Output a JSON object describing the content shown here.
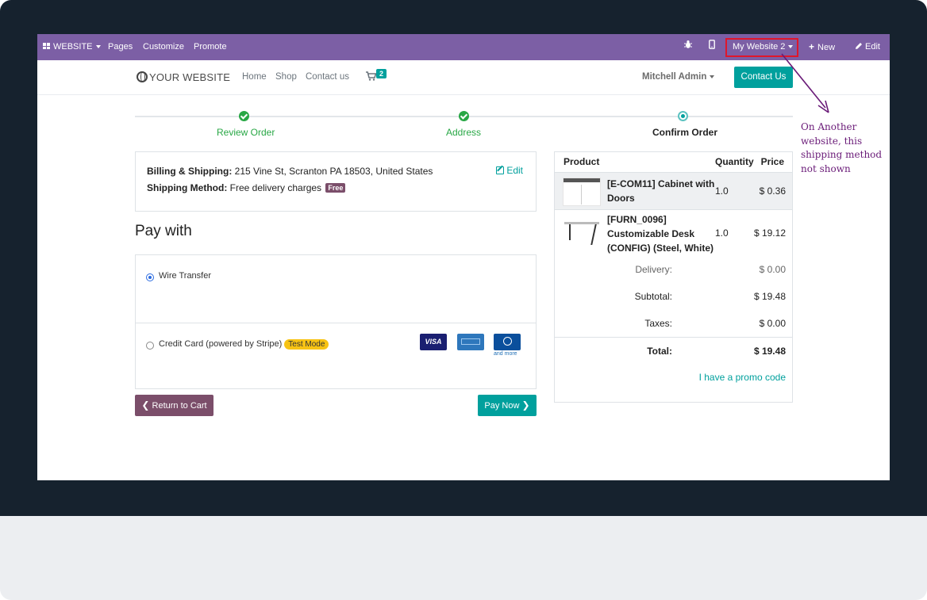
{
  "admin_bar": {
    "website_menu": "WEBSITE",
    "pages": "Pages",
    "customize": "Customize",
    "promote": "Promote",
    "website_switcher": "My Website 2",
    "new": "New",
    "edit": "Edit"
  },
  "header": {
    "logo": "YOUR WEBSITE",
    "nav": [
      "Home",
      "Shop",
      "Contact us"
    ],
    "cart_count": "2",
    "user": "Mitchell Admin",
    "contact_button": "Contact Us"
  },
  "progress": {
    "steps": [
      {
        "label": "Review Order",
        "state": "done"
      },
      {
        "label": "Address",
        "state": "done"
      },
      {
        "label": "Confirm Order",
        "state": "current"
      }
    ]
  },
  "billing": {
    "billing_label": "Billing & Shipping:",
    "billing_value": "215 Vine St, Scranton PA 18503, United States",
    "shipping_label": "Shipping Method:",
    "shipping_value": "Free delivery charges",
    "free_badge": "Free",
    "edit": "Edit"
  },
  "payment": {
    "heading": "Pay with",
    "options": [
      {
        "label": "Wire Transfer",
        "selected": true
      },
      {
        "label": "Credit Card (powered by Stripe)",
        "selected": false,
        "badge": "Test Mode"
      }
    ],
    "card_logos": [
      "VISA",
      "amex-logo",
      "diners-logo"
    ],
    "and_more": "and more",
    "return_button": "Return to Cart",
    "pay_button": "Pay Now"
  },
  "summary": {
    "columns": [
      "Product",
      "Quantity",
      "Price"
    ],
    "products": [
      {
        "name_line1": "[E-COM11] Cabinet with",
        "name_line2": "Doors",
        "quantity": "1.0",
        "price": "$ 0.36"
      },
      {
        "name_line1": "[FURN_0096]",
        "name_line2": "Customizable Desk",
        "name_line3": "(CONFIG) (Steel, White)",
        "quantity": "1.0",
        "price": "$ 19.12"
      }
    ],
    "delivery_label": "Delivery:",
    "delivery_value": "$ 0.00",
    "subtotal_label": "Subtotal:",
    "subtotal_value": "$ 19.48",
    "taxes_label": "Taxes:",
    "taxes_value": "$ 0.00",
    "total_label": "Total:",
    "total_value": "$ 19.48",
    "promo": "I have a promo code"
  },
  "annotation": {
    "line1": "On Another",
    "line2": "website, this",
    "line3": "shipping method",
    "line4": "not shown"
  },
  "colors": {
    "admin_bar": "#7c5fa5",
    "primary": "#00a09d",
    "secondary": "#7b4e6a",
    "success": "#28a745",
    "annotation": "#6a1b78",
    "highlight": "#e0162b"
  }
}
